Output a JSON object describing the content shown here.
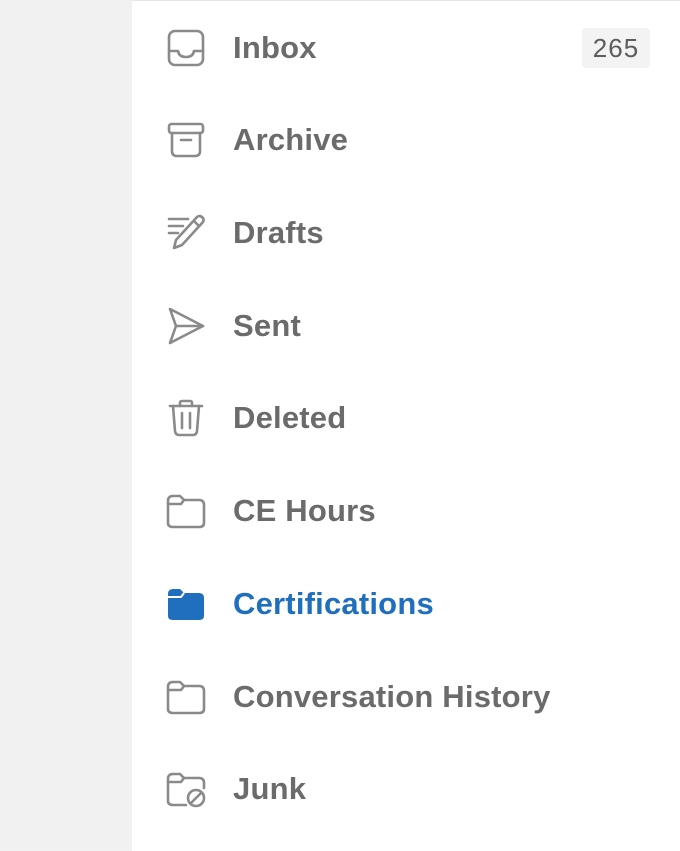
{
  "folders": [
    {
      "label": "Inbox",
      "icon": "inbox-icon",
      "badge": "265"
    },
    {
      "label": "Archive",
      "icon": "archive-icon"
    },
    {
      "label": "Drafts",
      "icon": "drafts-pencil-icon"
    },
    {
      "label": "Sent",
      "icon": "sent-paper-plane-icon"
    },
    {
      "label": "Deleted",
      "icon": "trash-icon"
    },
    {
      "label": "CE Hours",
      "icon": "folder-icon"
    },
    {
      "label": "Certifications",
      "icon": "folder-filled-icon",
      "selected": true
    },
    {
      "label": "Conversation History",
      "icon": "folder-icon"
    },
    {
      "label": "Junk",
      "icon": "junk-folder-icon"
    }
  ],
  "colors": {
    "accent": "#1f6fbe",
    "label": "#6b6b6b",
    "icon": "#8a8a8a",
    "gutter": "#f1f1f1",
    "badge_bg": "#f3f3f3"
  }
}
